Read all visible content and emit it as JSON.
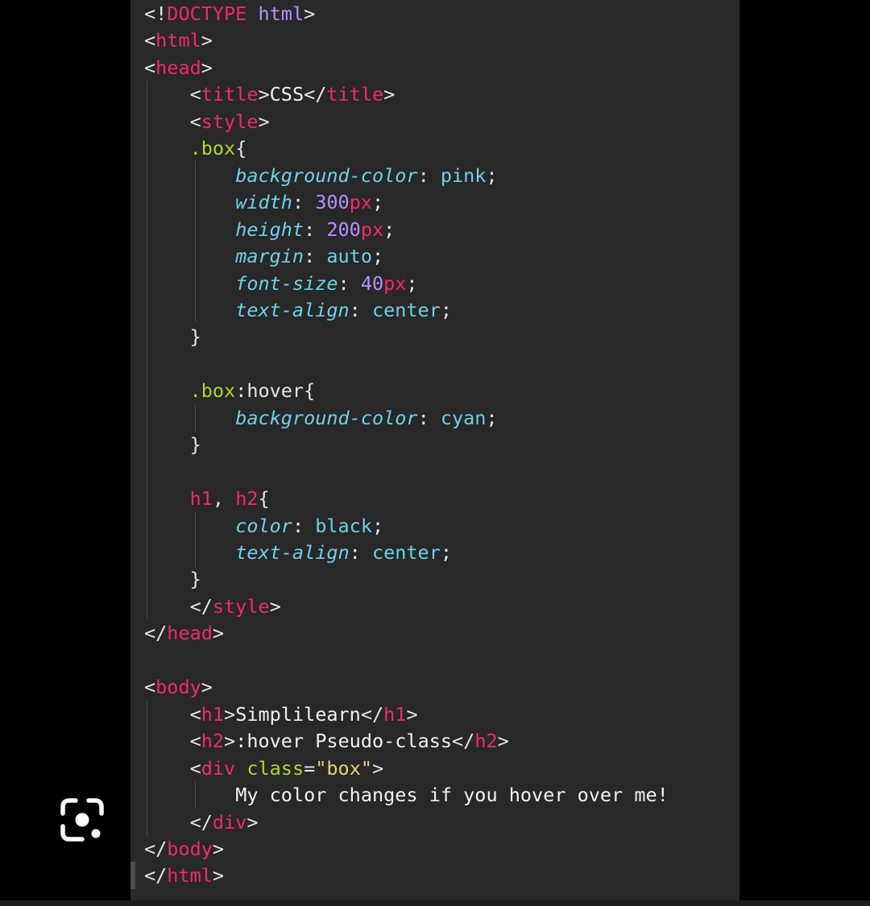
{
  "editor": {
    "lines": [
      [
        [
          "punct",
          "<!"
        ],
        [
          "doctype",
          "DOCTYPE"
        ],
        [
          "punct",
          " "
        ],
        [
          "kw",
          "html"
        ],
        [
          "punct",
          ">"
        ]
      ],
      [
        [
          "punct",
          "<"
        ],
        [
          "tag",
          "html"
        ],
        [
          "punct",
          ">"
        ]
      ],
      [
        [
          "punct",
          "<"
        ],
        [
          "tag",
          "head"
        ],
        [
          "punct",
          ">"
        ]
      ],
      [
        [
          "punct",
          "    <"
        ],
        [
          "tag",
          "title"
        ],
        [
          "punct",
          ">"
        ],
        [
          "text",
          "CSS"
        ],
        [
          "punct",
          "</"
        ],
        [
          "tag",
          "title"
        ],
        [
          "punct",
          ">"
        ]
      ],
      [
        [
          "punct",
          "    <"
        ],
        [
          "tag",
          "style"
        ],
        [
          "punct",
          ">"
        ]
      ],
      [
        [
          "punct",
          "    "
        ],
        [
          "sel",
          ".box"
        ],
        [
          "punct",
          "{"
        ]
      ],
      [
        [
          "punct",
          "        "
        ],
        [
          "prop",
          "background-color"
        ],
        [
          "punct",
          ": "
        ],
        [
          "val",
          "pink"
        ],
        [
          "punct",
          ";"
        ]
      ],
      [
        [
          "punct",
          "        "
        ],
        [
          "prop",
          "width"
        ],
        [
          "punct",
          ": "
        ],
        [
          "num",
          "300"
        ],
        [
          "unit",
          "px"
        ],
        [
          "punct",
          ";"
        ]
      ],
      [
        [
          "punct",
          "        "
        ],
        [
          "prop",
          "height"
        ],
        [
          "punct",
          ": "
        ],
        [
          "num",
          "200"
        ],
        [
          "unit",
          "px"
        ],
        [
          "punct",
          ";"
        ]
      ],
      [
        [
          "punct",
          "        "
        ],
        [
          "prop",
          "margin"
        ],
        [
          "punct",
          ": "
        ],
        [
          "val",
          "auto"
        ],
        [
          "punct",
          ";"
        ]
      ],
      [
        [
          "punct",
          "        "
        ],
        [
          "prop",
          "font-size"
        ],
        [
          "punct",
          ": "
        ],
        [
          "num",
          "40"
        ],
        [
          "unit",
          "px"
        ],
        [
          "punct",
          ";"
        ]
      ],
      [
        [
          "punct",
          "        "
        ],
        [
          "prop",
          "text-align"
        ],
        [
          "punct",
          ": "
        ],
        [
          "val",
          "center"
        ],
        [
          "punct",
          ";"
        ]
      ],
      [
        [
          "punct",
          "    }"
        ]
      ],
      [],
      [
        [
          "punct",
          "    "
        ],
        [
          "sel",
          ".box"
        ],
        [
          "punct",
          ":hover{"
        ]
      ],
      [
        [
          "punct",
          "        "
        ],
        [
          "prop",
          "background-color"
        ],
        [
          "punct",
          ": "
        ],
        [
          "val",
          "cyan"
        ],
        [
          "punct",
          ";"
        ]
      ],
      [
        [
          "punct",
          "    }"
        ]
      ],
      [],
      [
        [
          "punct",
          "    "
        ],
        [
          "tag",
          "h1"
        ],
        [
          "punct",
          ", "
        ],
        [
          "tag",
          "h2"
        ],
        [
          "punct",
          "{"
        ]
      ],
      [
        [
          "punct",
          "        "
        ],
        [
          "prop",
          "color"
        ],
        [
          "punct",
          ": "
        ],
        [
          "val",
          "black"
        ],
        [
          "punct",
          ";"
        ]
      ],
      [
        [
          "punct",
          "        "
        ],
        [
          "prop",
          "text-align"
        ],
        [
          "punct",
          ": "
        ],
        [
          "val",
          "center"
        ],
        [
          "punct",
          ";"
        ]
      ],
      [
        [
          "punct",
          "    }"
        ]
      ],
      [
        [
          "punct",
          "    </"
        ],
        [
          "tag",
          "style"
        ],
        [
          "punct",
          ">"
        ]
      ],
      [
        [
          "punct",
          "</"
        ],
        [
          "tag",
          "head"
        ],
        [
          "punct",
          ">"
        ]
      ],
      [],
      [
        [
          "punct",
          "<"
        ],
        [
          "tag",
          "body"
        ],
        [
          "punct",
          ">"
        ]
      ],
      [
        [
          "punct",
          "    <"
        ],
        [
          "tag",
          "h1"
        ],
        [
          "punct",
          ">"
        ],
        [
          "text",
          "Simplilearn"
        ],
        [
          "punct",
          "</"
        ],
        [
          "tag",
          "h1"
        ],
        [
          "punct",
          ">"
        ]
      ],
      [
        [
          "punct",
          "    <"
        ],
        [
          "tag",
          "h2"
        ],
        [
          "punct",
          ">"
        ],
        [
          "text",
          ":hover Pseudo-class"
        ],
        [
          "punct",
          "</"
        ],
        [
          "tag",
          "h2"
        ],
        [
          "punct",
          ">"
        ]
      ],
      [
        [
          "punct",
          "    <"
        ],
        [
          "tag",
          "div"
        ],
        [
          "punct",
          " "
        ],
        [
          "attr",
          "class"
        ],
        [
          "punct",
          "="
        ],
        [
          "str",
          "\"box\""
        ],
        [
          "punct",
          ">"
        ]
      ],
      [
        [
          "punct",
          "        "
        ],
        [
          "text",
          "My color changes if you hover over me!"
        ]
      ],
      [
        [
          "punct",
          "    </"
        ],
        [
          "tag",
          "div"
        ],
        [
          "punct",
          ">"
        ]
      ],
      [
        [
          "punct",
          "</"
        ],
        [
          "tag",
          "body"
        ],
        [
          "punct",
          ">"
        ]
      ],
      [
        [
          "punct",
          "</"
        ],
        [
          "tag",
          "html"
        ],
        [
          "punct",
          ">"
        ]
      ]
    ]
  },
  "overlay": {
    "icon": "google-lens-icon"
  },
  "colors": {
    "background": "#000000",
    "editor_bg": "#282828",
    "tag": "#f2296b",
    "property": "#6fd1e6",
    "number": "#b591ff",
    "selector": "#b5d335",
    "string": "#e2d66d",
    "text": "#f2f2f2"
  }
}
